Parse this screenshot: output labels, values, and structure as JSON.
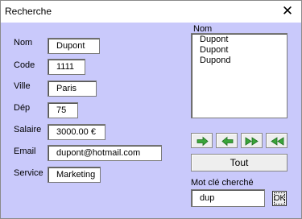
{
  "window": {
    "title": "Recherche",
    "close_glyph": "✕"
  },
  "form": {
    "fields": [
      {
        "label": "Nom",
        "value": "Dupont"
      },
      {
        "label": "Code",
        "value": "1111"
      },
      {
        "label": "Ville",
        "value": "Paris"
      },
      {
        "label": "Dép",
        "value": "75"
      },
      {
        "label": "Salaire",
        "value": "3000.00 €"
      },
      {
        "label": "Email",
        "value": "dupont@hotmail.com"
      },
      {
        "label": "Service",
        "value": "Marketing"
      }
    ]
  },
  "list": {
    "header": "Nom",
    "items": [
      "Dupont",
      "Dupont",
      "Dupond"
    ]
  },
  "nav": {
    "buttons": [
      {
        "icon": "arrow-right-icon"
      },
      {
        "icon": "arrow-left-icon"
      },
      {
        "icon": "double-arrow-right-icon"
      },
      {
        "icon": "double-arrow-left-icon"
      }
    ],
    "arrow_color": "#3aa53a"
  },
  "tout_label": "Tout",
  "search": {
    "label": "Mot clé cherché",
    "value": "dup",
    "ok_label": "OK"
  }
}
